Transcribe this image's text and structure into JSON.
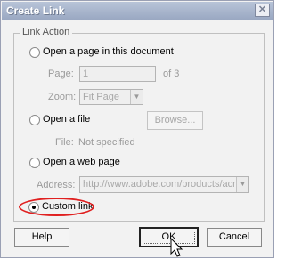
{
  "dialog": {
    "title": "Create Link",
    "close_glyph": "✕"
  },
  "link_action": {
    "legend": "Link Action",
    "page_option": {
      "label": "Open a page in this document",
      "page_label": "Page:",
      "page_value": "1",
      "page_suffix": "of 3",
      "zoom_label": "Zoom:",
      "zoom_value": "Fit Page"
    },
    "file_option": {
      "label": "Open a file",
      "browse_label": "Browse...",
      "file_label": "File:",
      "file_value": "Not specified"
    },
    "web_option": {
      "label": "Open a web page",
      "address_label": "Address:",
      "address_value": "http://www.adobe.com/products/acrobat"
    },
    "custom_option": {
      "label": "Custom link",
      "selected": true
    }
  },
  "buttons": {
    "help": "Help",
    "ok": "OK",
    "cancel": "Cancel"
  },
  "colors": {
    "highlight": "#e02020",
    "titlebar": "#9aa8c2"
  }
}
